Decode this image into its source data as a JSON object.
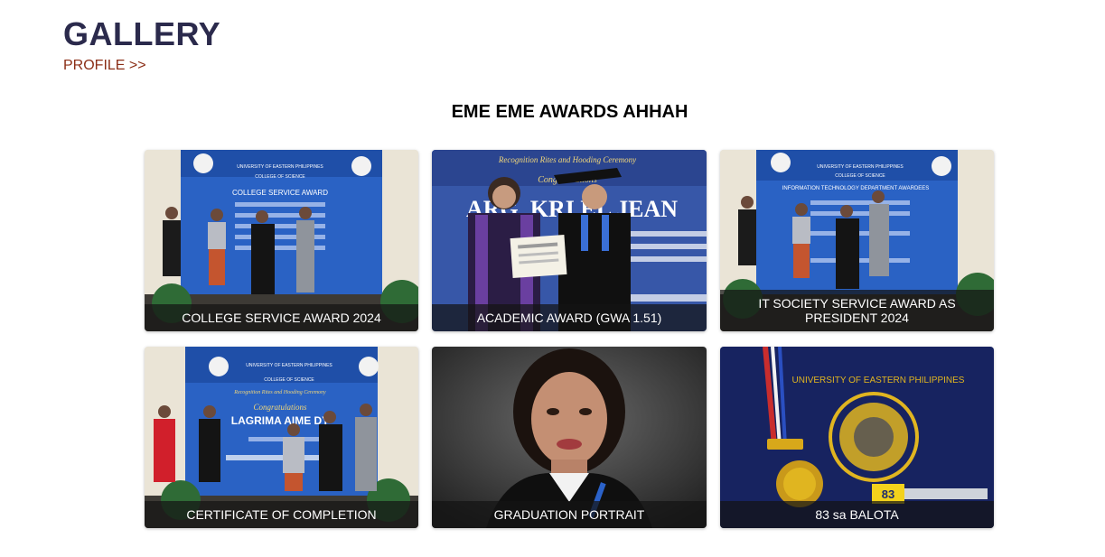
{
  "header": {
    "title": "GALLERY",
    "profile_link": "PROFILE >>"
  },
  "section": {
    "title": "EME EME AWARDS AHHAH"
  },
  "gallery": {
    "items": [
      {
        "caption": "COLLEGE SERVICE AWARD 2024",
        "photo": "college-service-award-photo"
      },
      {
        "caption": "ACADEMIC AWARD (GWA 1.51)",
        "photo": "academic-award-photo"
      },
      {
        "caption": "IT SOCIETY SERVICE AWARD AS PRESIDENT 2024",
        "photo": "it-society-award-photo"
      },
      {
        "caption": "CERTIFICATE OF COMPLETION",
        "photo": "certificate-completion-photo"
      },
      {
        "caption": "GRADUATION PORTRAIT",
        "photo": "graduation-portrait-photo"
      },
      {
        "caption": "83 sa BALOTA",
        "photo": "diploma-medal-photo"
      }
    ]
  },
  "photo_text": {
    "university": "UNIVERSITY OF EASTERN PHILIPPINES",
    "college": "COLLEGE OF SCIENCE",
    "stage_award_1": "COLLEGE SERVICE AWARD",
    "stage_ceremony": "Recognition Rites and Hooding Ceremony",
    "stage_congrats": "Congratulations",
    "stage_name_2": "ARG, KRI EL JEAN",
    "stage_award_3": "INFORMATION TECHNOLOGY DEPARTMENT AWARDEES",
    "stage_name_4": "LAGRIMA AIME DY",
    "diploma_university": "UNIVERSITY OF EASTERN PHILIPPINES",
    "tag_number": "83"
  },
  "colors": {
    "title": "#2b2a4c",
    "link": "#8b2e16",
    "caption_bg": "rgba(20,20,20,0.72)",
    "stage_blue": "#1f4fa8",
    "diploma_blue": "#1c2a6e",
    "gold": "#e0b520"
  }
}
